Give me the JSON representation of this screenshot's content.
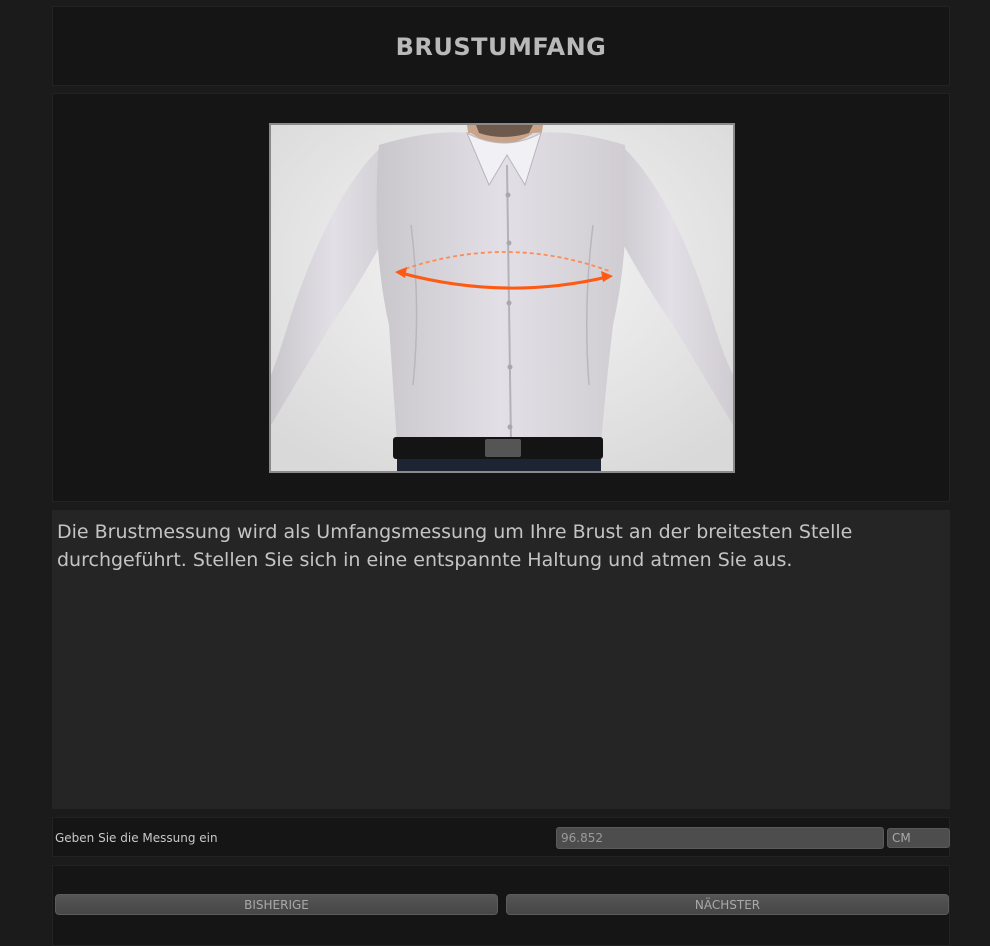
{
  "header": {
    "title": "BRUSTUMFANG"
  },
  "description": {
    "text": "Die Brustmessung wird als Umfangsmessung um Ihre Brust an der breitesten Stelle durchgeführt. Stellen Sie sich in eine entspannte Haltung und atmen Sie aus."
  },
  "measurement": {
    "label": "Geben Sie die Messung ein",
    "value": "96.852",
    "unit": "CM"
  },
  "navigation": {
    "previous_label": "BISHERIGE",
    "next_label": "NÄCHSTER"
  },
  "colors": {
    "background": "#1b1b1b",
    "panel": "#151515",
    "description_panel": "#252525",
    "measure_line": "#ff5a14"
  },
  "icons": {
    "illustration": "man-in-shirt-chest-measurement"
  }
}
